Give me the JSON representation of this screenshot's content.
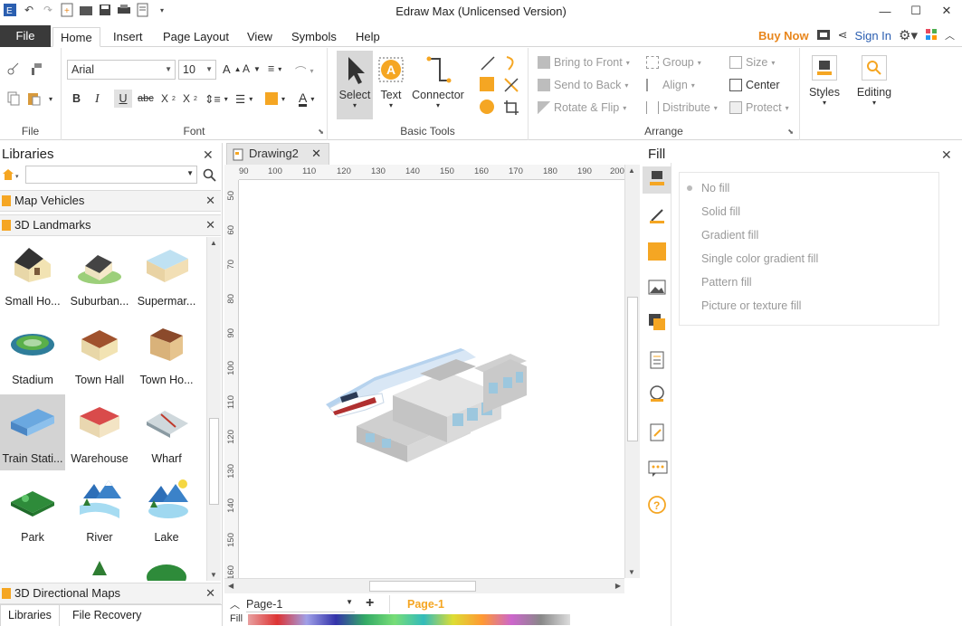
{
  "window": {
    "title": "Edraw Max (Unlicensed Version)"
  },
  "tabs": [
    {
      "label": "File"
    },
    {
      "label": "Home"
    },
    {
      "label": "Insert"
    },
    {
      "label": "Page Layout"
    },
    {
      "label": "View"
    },
    {
      "label": "Symbols"
    },
    {
      "label": "Help"
    }
  ],
  "account": {
    "buy_now": "Buy Now",
    "sign_in": "Sign In"
  },
  "ribbon": {
    "file_group": "File",
    "font_group": "Font",
    "font_name": "Arial",
    "font_size": "10",
    "basic_tools_group": "Basic Tools",
    "select": "Select",
    "text": "Text",
    "connector": "Connector",
    "arrange_group": "Arrange",
    "bring_to_front": "Bring to Front",
    "send_to_back": "Send to Back",
    "rotate_flip": "Rotate & Flip",
    "group": "Group",
    "align": "Align",
    "distribute": "Distribute",
    "size": "Size",
    "center": "Center",
    "protect": "Protect",
    "styles": "Styles",
    "editing": "Editing"
  },
  "libraries": {
    "title": "Libraries",
    "sections": [
      "Map Vehicles",
      "3D Landmarks"
    ],
    "bottom_section": "3D Directional Maps",
    "shapes": [
      {
        "label": "Small Ho..."
      },
      {
        "label": "Suburban..."
      },
      {
        "label": "Supermar..."
      },
      {
        "label": "Stadium"
      },
      {
        "label": "Town Hall"
      },
      {
        "label": "Town Ho..."
      },
      {
        "label": "Train Stati..."
      },
      {
        "label": "Warehouse"
      },
      {
        "label": "Wharf"
      },
      {
        "label": "Park"
      },
      {
        "label": "River"
      },
      {
        "label": "Lake"
      }
    ],
    "bottom_tabs": [
      "Libraries",
      "File Recovery"
    ]
  },
  "document": {
    "tab": "Drawing2",
    "hruler": [
      "90",
      "100",
      "110",
      "120",
      "130",
      "140",
      "150",
      "160",
      "170",
      "180",
      "190",
      "200"
    ],
    "vruler": [
      "50",
      "60",
      "70",
      "80",
      "90",
      "100",
      "110",
      "120",
      "130",
      "140",
      "150",
      "160"
    ],
    "page_select": "Page-1",
    "page_tab": "Page-1",
    "fill_label": "Fill"
  },
  "fill_panel": {
    "title": "Fill",
    "options": [
      "No fill",
      "Solid fill",
      "Gradient fill",
      "Single color gradient fill",
      "Pattern fill",
      "Picture or texture fill"
    ]
  },
  "colors": {
    "accent": "#f5a623",
    "file_tab": "#3a3a3a",
    "buy_now": "#e8861c",
    "sign_in": "#2a5db0"
  }
}
